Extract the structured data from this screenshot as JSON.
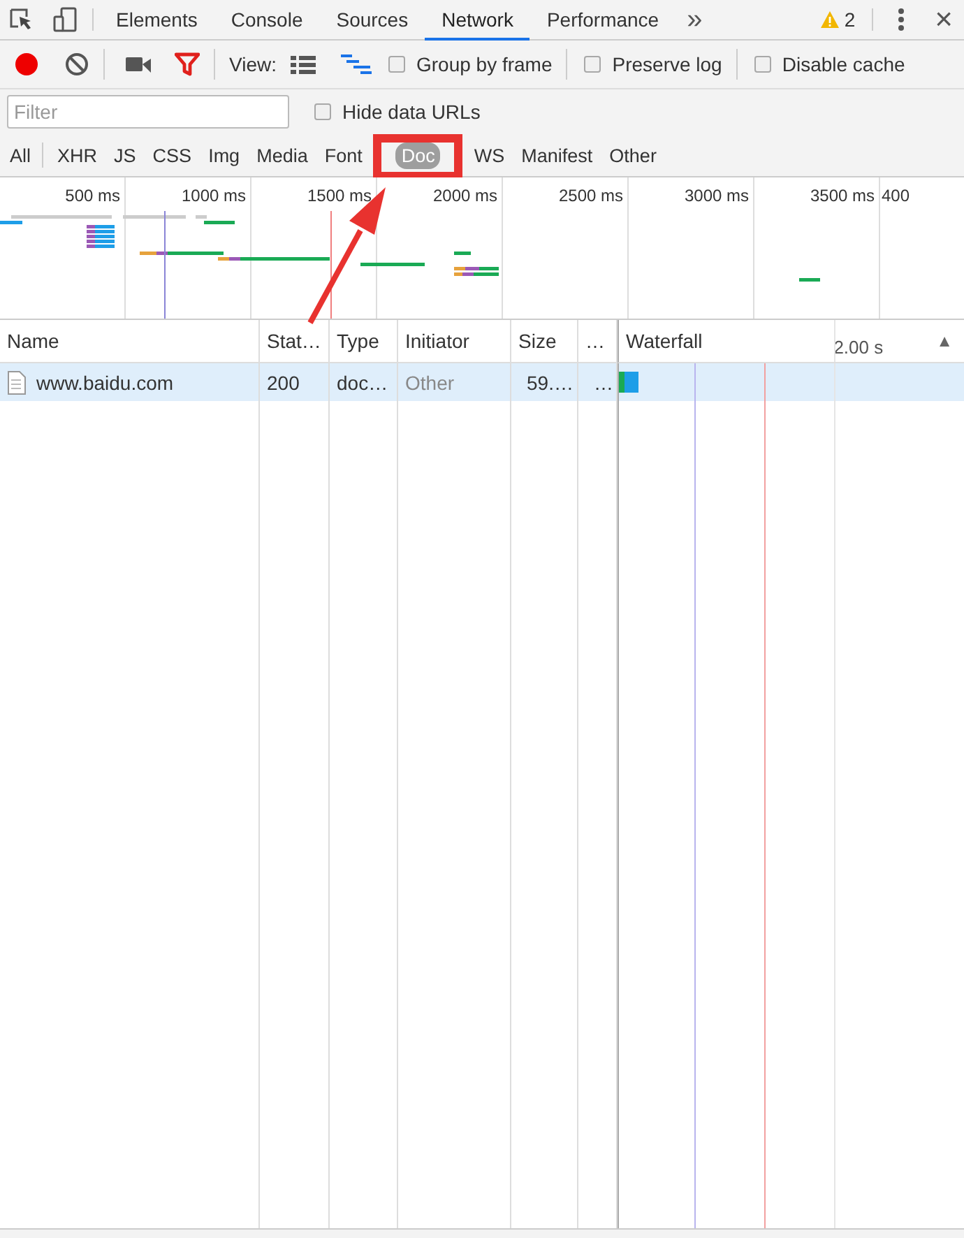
{
  "main_tabs": [
    {
      "label": "Elements",
      "selected": false
    },
    {
      "label": "Console",
      "selected": false
    },
    {
      "label": "Sources",
      "selected": false
    },
    {
      "label": "Network",
      "selected": true
    },
    {
      "label": "Performance",
      "selected": false
    }
  ],
  "more_tabs": "»",
  "warnings": {
    "count": "2"
  },
  "close": "×",
  "toolbar": {
    "recording": true,
    "view_label": "View:",
    "checkboxes": [
      {
        "label": "Group by frame",
        "checked": false
      },
      {
        "label": "Preserve log",
        "checked": false
      },
      {
        "label": "Disable cache",
        "checked": false
      }
    ]
  },
  "filter": {
    "placeholder": "Filter",
    "hide_data_urls": {
      "label": "Hide data URLs",
      "checked": false
    }
  },
  "type_filters": [
    {
      "label": "All",
      "selected": false
    },
    {
      "label": "XHR",
      "selected": false
    },
    {
      "label": "JS",
      "selected": false
    },
    {
      "label": "CSS",
      "selected": false
    },
    {
      "label": "Img",
      "selected": false
    },
    {
      "label": "Media",
      "selected": false
    },
    {
      "label": "Font",
      "selected": false
    },
    {
      "label": "Doc",
      "selected": true
    },
    {
      "label": "WS",
      "selected": false
    },
    {
      "label": "Manifest",
      "selected": false
    },
    {
      "label": "Other",
      "selected": false
    }
  ],
  "overview": {
    "ticks": [
      "500 ms",
      "1000 ms",
      "1500 ms",
      "2000 ms",
      "2500 ms",
      "3000 ms",
      "3500 ms",
      "400"
    ]
  },
  "table": {
    "columns": [
      "Name",
      "Stat…",
      "Type",
      "Initiator",
      "Size",
      "…",
      "Waterfall"
    ],
    "waterfall_scale": "2.00 s",
    "sort_indicator": "▲",
    "rows": [
      {
        "name": "www.baidu.com",
        "status": "200",
        "type": "doc…",
        "initiator": "Other",
        "size": "59.…",
        "column_6": "…",
        "selected": true
      }
    ]
  }
}
